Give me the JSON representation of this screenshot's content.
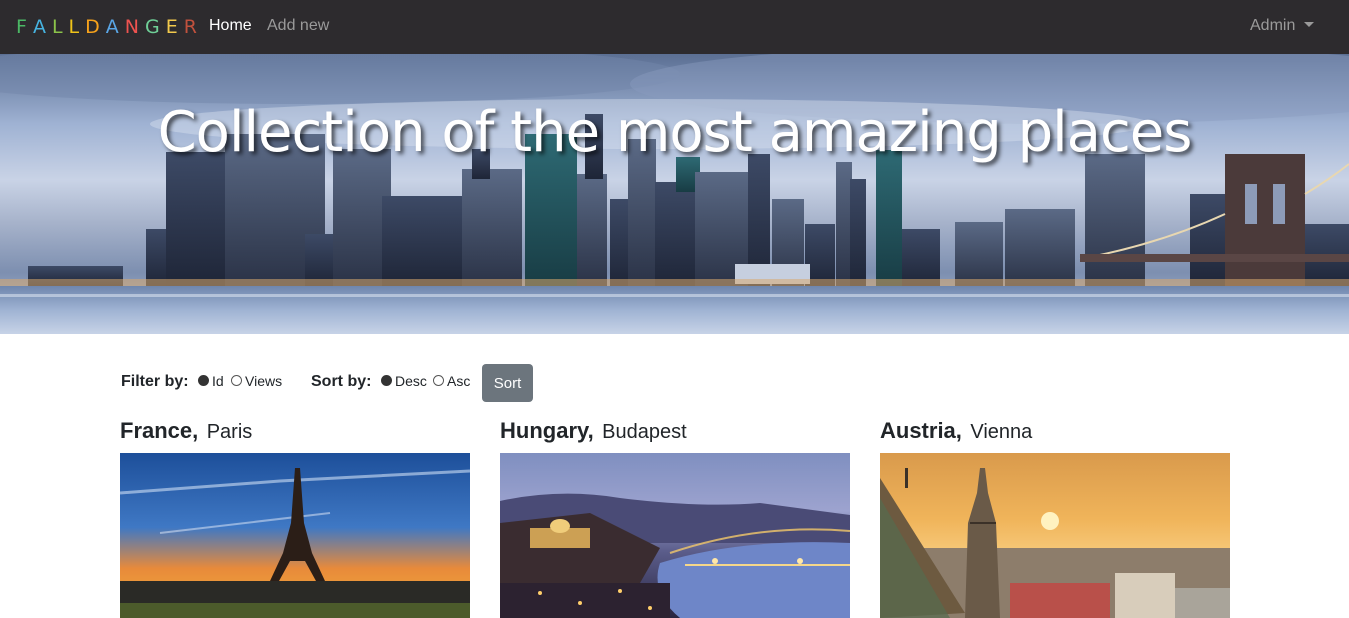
{
  "navbar": {
    "brand_letters": [
      "F",
      "A",
      "L",
      "L",
      "D",
      "A",
      "N",
      "G",
      "E",
      "R"
    ],
    "brand_colors": [
      "#4bb865",
      "#46b3e0",
      "#8bc34a",
      "#f0c419",
      "#f7a21b",
      "#5aa6e6",
      "#ef5350",
      "#6fcf97",
      "#f2c94c",
      "#c0513d"
    ],
    "home_label": "Home",
    "add_new_label": "Add new",
    "admin_label": "Admin"
  },
  "hero": {
    "title": "Collection of the most amazing places"
  },
  "filters": {
    "filter_label": "Filter by:",
    "filter_options": [
      "Id",
      "Views"
    ],
    "filter_selected": "Id",
    "sort_label": "Sort by:",
    "sort_options": [
      "Desc",
      "Asc"
    ],
    "sort_selected": "Desc",
    "sort_button_label": "Sort"
  },
  "places": [
    {
      "country": "France,",
      "city": "Paris",
      "image_icon": "eiffel-tower-image"
    },
    {
      "country": "Hungary,",
      "city": "Budapest",
      "image_icon": "budapest-night-image"
    },
    {
      "country": "Austria,",
      "city": "Vienna",
      "image_icon": "vienna-sunset-image"
    }
  ]
}
